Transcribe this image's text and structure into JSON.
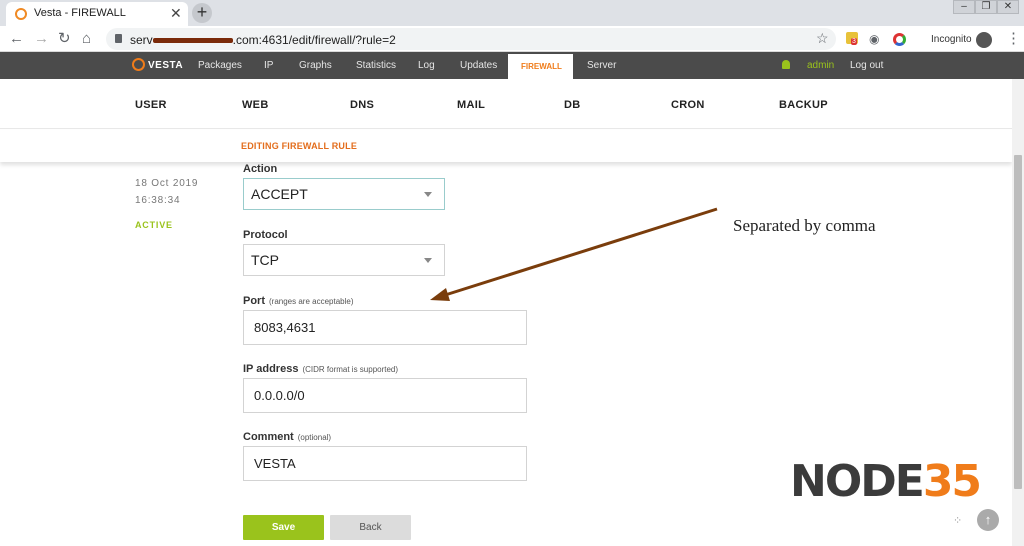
{
  "browser": {
    "tab_title": "Vesta - FIREWALL",
    "tab_close": "✕",
    "new_tab": "+",
    "url_prefix": "serv",
    "url_suffix": ".com:4631/edit/firewall/?rule=2",
    "incognito": "Incognito",
    "ext_badge": "3"
  },
  "topnav": {
    "logo": "VESTA",
    "items": [
      "Packages",
      "IP",
      "Graphs",
      "Statistics",
      "Log",
      "Updates",
      "FIREWALL",
      "Server"
    ],
    "user": "admin",
    "logout": "Log out"
  },
  "sections": [
    "USER",
    "WEB",
    "DNS",
    "MAIL",
    "DB",
    "CRON",
    "BACKUP"
  ],
  "page": {
    "title": "EDITING FIREWALL RULE",
    "date": "18 Oct 2019",
    "time": "16:38:34",
    "status": "ACTIVE"
  },
  "form": {
    "action_label": "Action",
    "action_value": "ACCEPT",
    "protocol_label": "Protocol",
    "protocol_value": "TCP",
    "port_label": "Port",
    "port_hint": "(ranges are acceptable)",
    "port_value": "8083,4631",
    "ip_label": "IP address",
    "ip_hint": "(CIDR format is supported)",
    "ip_value": "0.0.0.0/0",
    "comment_label": "Comment",
    "comment_hint": "(optional)",
    "comment_value": "VESTA",
    "save": "Save",
    "back": "Back"
  },
  "annotation": "Separated by comma",
  "brand": {
    "part1": "NODE",
    "part2": "35"
  },
  "colors": {
    "accent": "#f07c1a",
    "save": "#9ac31c",
    "nav_bg": "#4b4b4b",
    "arrow": "#7a3d0c"
  }
}
